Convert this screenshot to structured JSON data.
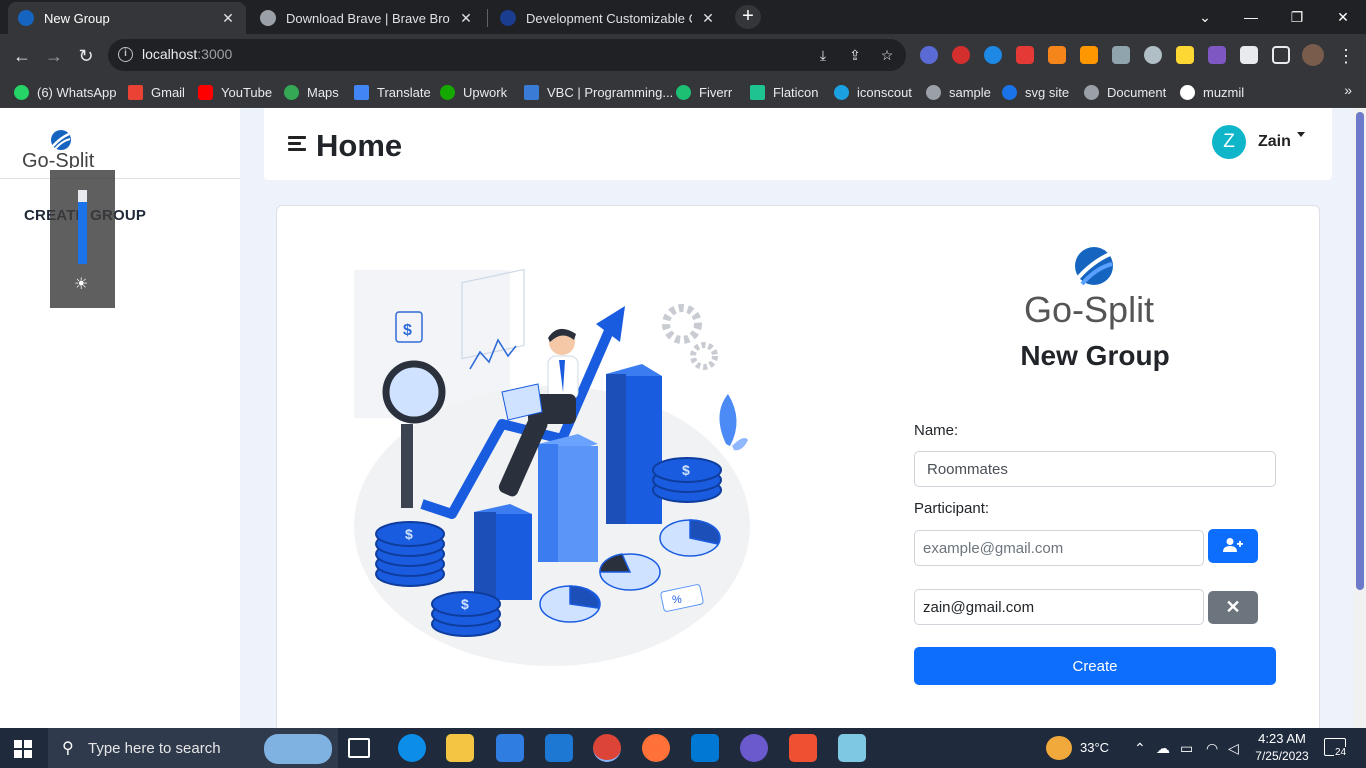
{
  "browser": {
    "tabs": [
      {
        "title": "New Group",
        "active": true,
        "favicon": "go-split-logo-icon"
      },
      {
        "title": "Download Brave | Brave Browser",
        "active": false,
        "favicon": "globe-icon"
      },
      {
        "title": "Development Customizable Cartoo",
        "active": false,
        "favicon": "swirl-icon"
      }
    ],
    "new_tab": "+",
    "window_controls": {
      "dropdown": "⌄",
      "minimize": "—",
      "restore": "❐",
      "close": "✕"
    },
    "nav": {
      "back": "←",
      "forward": "→",
      "reload": "↻"
    },
    "url_host": "localhost",
    "url_port": ":3000",
    "bookmarks": [
      {
        "label": "(6) WhatsApp",
        "color": "#25d366"
      },
      {
        "label": "Gmail",
        "color": "#ea4335"
      },
      {
        "label": "YouTube",
        "color": "#ff0000"
      },
      {
        "label": "Maps",
        "color": "#34a853"
      },
      {
        "label": "Translate",
        "color": "#4285f4"
      },
      {
        "label": "Upwork",
        "color": "#14a800"
      },
      {
        "label": "VBC | Programming...",
        "color": "#3a7bd5"
      },
      {
        "label": "Fiverr",
        "color": "#1dbf73"
      },
      {
        "label": "Flaticon",
        "color": "#1ec391"
      },
      {
        "label": "iconscout",
        "color": "#1ba1e2"
      },
      {
        "label": "sample",
        "color": "#9aa0a6"
      },
      {
        "label": "svg site",
        "color": "#1a73e8"
      },
      {
        "label": "Document",
        "color": "#9aa0a6"
      },
      {
        "label": "muzmil",
        "color": "#ffffff"
      }
    ],
    "bookmarks_more": "»"
  },
  "app": {
    "brand": {
      "go": "Go",
      "dash": "-",
      "split": "Split"
    },
    "sidebar": {
      "items": [
        {
          "label": "CREATE GROUP"
        }
      ]
    },
    "header": {
      "title": "Home",
      "user_initial": "Z",
      "user_name": "Zain"
    },
    "form": {
      "title": "New Group",
      "name_label": "Name:",
      "name_value": "Roommates",
      "participant_label": "Participant:",
      "participant_placeholder": "example@gmail.com",
      "participants": [
        "zain@gmail.com"
      ],
      "remove_label": "✕",
      "create_label": "Create"
    }
  },
  "taskbar": {
    "search_placeholder": "Type here to search",
    "weather": "33°C",
    "time": "4:23 AM",
    "date": "7/25/2023",
    "notifications": "24"
  },
  "colors": {
    "primary": "#0d6efd",
    "secondary": "#6c757d",
    "avatar": "#0fb5c8",
    "page_bg": "#eef2fa"
  }
}
